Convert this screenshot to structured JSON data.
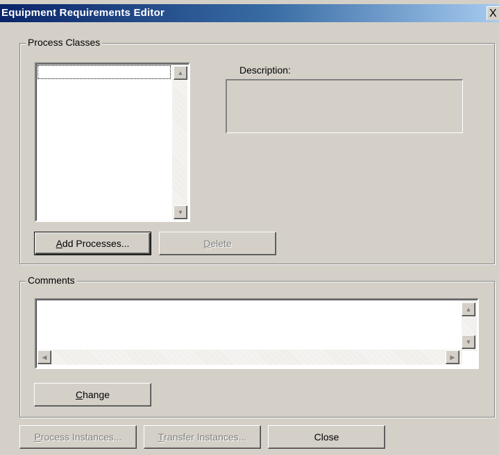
{
  "window": {
    "title": "Equipment Requirements Editor",
    "close_glyph": "X"
  },
  "process_classes": {
    "legend": "Process Classes",
    "items": [],
    "description_label": "Description:",
    "description_value": "",
    "add_button": {
      "mnemonic": "A",
      "rest": "dd Processes..."
    },
    "delete_button": {
      "mnemonic": "D",
      "rest": "elete"
    }
  },
  "comments": {
    "legend": "Comments",
    "value": "",
    "change_button": {
      "mnemonic": "C",
      "rest": "hange"
    }
  },
  "footer": {
    "process_instances": {
      "mnemonic": "P",
      "rest": "rocess Instances..."
    },
    "transfer_instances": {
      "mnemonic": "T",
      "rest": "ransfer Instances..."
    },
    "close_label": "Close"
  },
  "icons": {
    "scroll_up": "scroll-up-arrow-icon",
    "scroll_down": "scroll-down-arrow-icon",
    "scroll_left": "scroll-left-arrow-icon",
    "scroll_right": "scroll-right-arrow-icon"
  }
}
